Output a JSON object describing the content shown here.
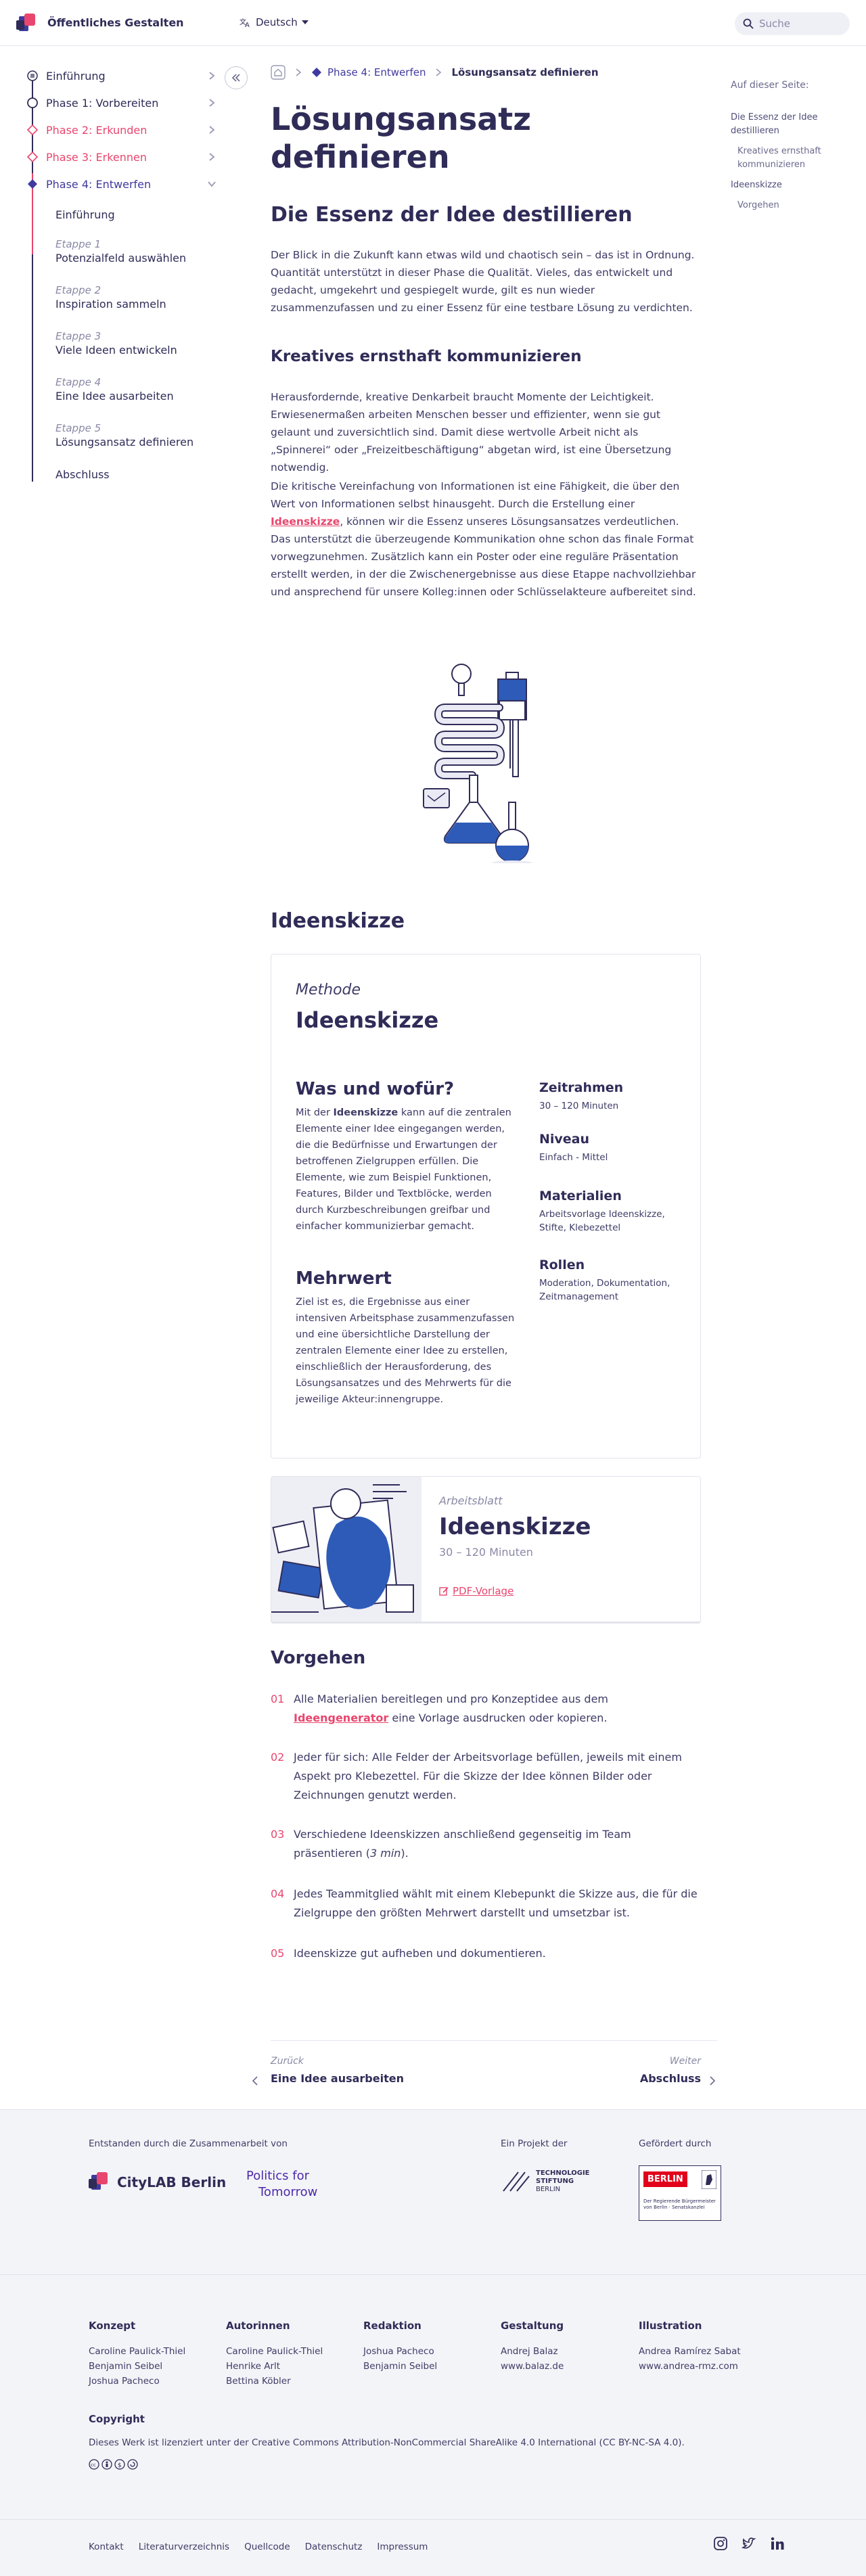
{
  "header": {
    "brand": "Öffentliches Gestalten",
    "language": "Deutsch",
    "search_placeholder": "Suche"
  },
  "sidebar": {
    "phases": [
      {
        "label": "Einführung",
        "color": "#2f2c58"
      },
      {
        "label": "Phase 1: Vorbereiten",
        "color": "#2f2c58"
      },
      {
        "label": "Phase 2: Erkunden",
        "color": "#e8466e"
      },
      {
        "label": "Phase 3: Erkennen",
        "color": "#e8466e"
      },
      {
        "label": "Phase 4: Entwerfen",
        "color": "#3f3a9e"
      }
    ],
    "sub_items": [
      {
        "eyebrow": "",
        "label": "Einführung"
      },
      {
        "eyebrow": "Etappe 1",
        "label": "Potenzialfeld auswählen"
      },
      {
        "eyebrow": "Etappe 2",
        "label": "Inspiration sammeln"
      },
      {
        "eyebrow": "Etappe 3",
        "label": "Viele Ideen entwickeln"
      },
      {
        "eyebrow": "Etappe 4",
        "label": "Eine Idee ausarbeiten"
      },
      {
        "eyebrow": "Etappe 5",
        "label": "Lösungsansatz definieren"
      },
      {
        "eyebrow": "",
        "label": "Abschluss"
      }
    ]
  },
  "breadcrumb": {
    "phase": "Phase 4: Entwerfen",
    "current": "Lösungsansatz definieren"
  },
  "page": {
    "title": "Lösungsansatz definieren",
    "h2_1": "Die Essenz der Idee destillieren",
    "p1": "Der Blick in die Zukunft kann etwas wild und chaotisch sein – das ist in Ordnung. Quantität unterstützt in dieser Phase die Qualität. Vieles, das entwickelt und gedacht, umgekehrt und gespiegelt wurde, gilt es nun wieder zusammenzufassen und zu einer Essenz für eine testbare Lösung zu verdichten.",
    "h3_1": "Kreatives ernsthaft kommunizieren",
    "p2": "Herausfordernde, kreative Denkarbeit braucht Momente der Leichtigkeit. Erwiesenermaßen arbeiten Menschen besser und effizienter, wenn sie gut gelaunt und zuversichtlich sind. Damit diese wertvolle Arbeit nicht als „Spinnerei“ oder „Freizeitbeschäftigung“ abgetan wird, ist eine Übersetzung notwendig.",
    "p3_a": "Die kritische Vereinfachung von Informationen ist eine Fähigkeit, die über den Wert von Informationen selbst hinausgeht. Durch die Erstellung einer ",
    "p3_link": "Ideenskizze",
    "p3_b": ", können wir die Essenz unseres Lösungsansatzes verdeutlichen. Das unterstützt die überzeugende Kommunikation ohne schon das finale Format vorwegzunehmen. Zusätzlich kann ein Poster oder eine reguläre Präsentation erstellt werden, in der die Zwischenergebnisse aus diese Etappe nachvollziehbar und ansprechend für unsere Kolleg:innen oder Schlüsselakteure aufbereitet sind.",
    "h2_2": "Ideenskizze"
  },
  "toc": {
    "heading": "Auf dieser Seite:",
    "items": [
      {
        "label": "Die Essenz der Idee destillieren",
        "level": 1
      },
      {
        "label": "Kreatives ernsthaft kommunizieren",
        "level": 2
      },
      {
        "label": "Ideenskizze",
        "level": 1
      },
      {
        "label": "Vorgehen",
        "level": 2
      }
    ]
  },
  "method": {
    "eyebrow": "Methode",
    "title": "Ideenskizze",
    "what_heading": "Was und wofür?",
    "what_a": "Mit der ",
    "what_bold": "Ideenskizze",
    "what_b": " kann auf die zentralen Elemente einer Idee eingegangen werden, die die Bedürfnisse und Erwartungen der betroffenen Zielgruppen erfüllen. Die Elemente, wie zum Beispiel Funktionen, Features, Bilder und Textblöcke, werden durch Kurzbeschreibungen greifbar und einfacher kommunizierbar gemacht.",
    "value_heading": "Mehrwert",
    "value_text": "Ziel ist es, die Ergebnisse aus einer intensiven Arbeitsphase zusammenzufassen und eine übersichtliche Darstellung der zentralen Elemente einer Idee zu erstellen, einschließlich der Herausforderung, des Lösungsansatzes und des Mehrwerts für die jeweilige Akteur:innengruppe.",
    "meta": [
      {
        "label": "Zeitrahmen",
        "value": "30 – 120 Minuten"
      },
      {
        "label": "Niveau",
        "value": "Einfach - Mittel"
      },
      {
        "label": "Materialien",
        "value": "Arbeitsvorlage Ideenskizze, Stifte, Klebezettel"
      },
      {
        "label": "Rollen",
        "value": "Moderation, Dokumentation, Zeitmanagement"
      }
    ]
  },
  "worksheet": {
    "eyebrow": "Arbeitsblatt",
    "title": "Ideenskizze",
    "duration": "30 – 120 Minuten",
    "pdf_label": "PDF-Vorlage"
  },
  "procedure": {
    "heading": "Vorgehen",
    "steps": [
      {
        "num": "01",
        "a": "Alle Materialien bereitlegen und pro Konzeptidee aus dem ",
        "link": "Ideengenerator",
        "b": " eine Vorlage ausdrucken oder kopieren."
      },
      {
        "num": "02",
        "a": "Jeder für sich: Alle Felder der Arbeitsvorlage befüllen, jeweils mit einem Aspekt pro Klebezettel. Für die Skizze der Idee können Bilder oder Zeichnungen genutzt werden.",
        "link": "",
        "b": ""
      },
      {
        "num": "03",
        "a": "Verschiedene Ideenskizzen anschließend gegenseitig im Team präsentieren (",
        "italic": "3 min",
        "b": ")."
      },
      {
        "num": "04",
        "a": "Jedes Teammitglied wählt mit einem Klebepunkt die Skizze aus, die für die Zielgruppe den größten Mehrwert darstellt und umsetzbar ist.",
        "link": "",
        "b": ""
      },
      {
        "num": "05",
        "a": "Ideenskizze gut aufheben und dokumentieren.",
        "link": "",
        "b": ""
      }
    ]
  },
  "pager": {
    "prev_label": "Zurück",
    "prev_title": "Eine Idee ausarbeiten",
    "next_label": "Weiter",
    "next_title": "Abschluss"
  },
  "footer": {
    "collab_label": "Entstanden durch die Zusammenarbeit von",
    "citylab": "CityLAB Berlin",
    "politics_1": "Politics for",
    "politics_2": "Tomorrow",
    "project_label": "Ein Projekt der",
    "tsb_1": "TECHNOLOGIE",
    "tsb_2": "STIFTUNG",
    "tsb_3": "BERLIN",
    "funded_label": "Gefördert durch",
    "berlin": "BERLIN",
    "berlin_sub": "Der Regierende Bürgermeister von Berlin · Senatskanzlei",
    "credits": [
      {
        "heading": "Konzept",
        "names": [
          "Caroline Paulick-Thiel",
          "Benjamin Seibel",
          "Joshua Pacheco"
        ]
      },
      {
        "heading": "Autorinnen",
        "names": [
          "Caroline Paulick-Thiel",
          "Henrike Arlt",
          "Bettina Köbler"
        ]
      },
      {
        "heading": "Redaktion",
        "names": [
          "Joshua Pacheco",
          "Benjamin Seibel"
        ]
      },
      {
        "heading": "Gestaltung",
        "names": [
          "Andrej Balaz",
          "www.balaz.de"
        ]
      },
      {
        "heading": "Illustration",
        "names": [
          "Andrea Ramírez Sabat",
          "www.andrea-rmz.com"
        ]
      }
    ],
    "copyright_heading": "Copyright",
    "copyright_text": "Dieses Werk ist lizenziert unter der Creative Commons Attribution-NonCommercial ShareAlike 4.0 International (CC BY-NC-SA 4.0).",
    "links": [
      "Kontakt",
      "Literaturverzeichnis",
      "Quellcode",
      "Datenschutz",
      "Impressum"
    ]
  },
  "colors": {
    "primary": "#2f2c58",
    "accent": "#e8466e",
    "phase4": "#3f3a9e",
    "illustration_blue": "#2e5bb8"
  }
}
